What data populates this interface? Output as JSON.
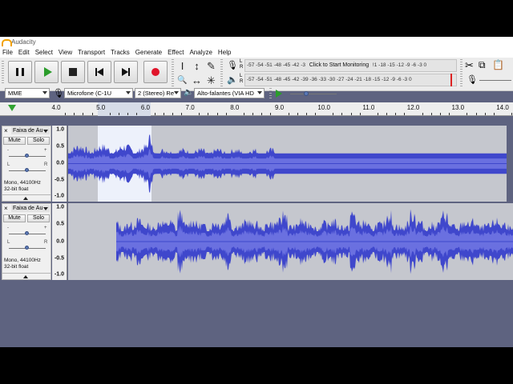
{
  "window": {
    "title": "Audacity"
  },
  "menu": [
    "File",
    "Edit",
    "Select",
    "View",
    "Transport",
    "Tracks",
    "Generate",
    "Effect",
    "Analyze",
    "Help"
  ],
  "transport": {
    "pause_icon": "pause-icon",
    "play_icon": "play-icon",
    "stop_icon": "stop-icon",
    "skip_start_icon": "skip-to-start-icon",
    "skip_end_icon": "skip-to-end-icon",
    "record_icon": "record-icon"
  },
  "tools": {
    "selection": "I",
    "envelope": "↕",
    "draw": "✎",
    "zoom": "🔍",
    "timeshift": "↔",
    "multi": "✳"
  },
  "meters": {
    "record_scale": "-57 -54 -51 -48 -45 -42 -3",
    "record_prompt": "Click to Start Monitoring",
    "record_scale_right": "!1 -18 -15 -12 -9 -6 -3 0",
    "playback_scale": "-57 -54 -51 -48 -45 -42 -39 -36 -33 -30 -27 -24 -21 -18 -15 -12 -9 -6 -3 0",
    "record_left": "L",
    "record_right": "R",
    "play_left": "L",
    "play_right": "R"
  },
  "device_toolbar": {
    "host": "MME",
    "input_device": "Microfone (C-1U",
    "channels": "2 (Stereo) Re",
    "output_device": "Alto-falantes (VIA HD"
  },
  "timeline": {
    "labels": [
      "4.0",
      "5.0",
      "6.0",
      "7.0",
      "8.0",
      "9.0",
      "10.0",
      "11.0",
      "12.0",
      "13.0",
      "14.0"
    ]
  },
  "tracks": [
    {
      "name": "Faixa de Áu",
      "mute": "Mute",
      "solo": "Solo",
      "gain_minus": "-",
      "gain_plus": "+",
      "pan_left": "L",
      "pan_right": "R",
      "rate": "Mono, 44100Hz",
      "format": "32-bit float",
      "scale": [
        "1.0",
        "0.5",
        "0.0",
        "-0.5",
        "-1.0"
      ]
    },
    {
      "name": "Faixa de Áu",
      "mute": "Mute",
      "solo": "Solo",
      "gain_minus": "-",
      "gain_plus": "+",
      "pan_left": "L",
      "pan_right": "R",
      "rate": "Mono, 44100Hz",
      "format": "32-bit float",
      "scale": [
        "1.0",
        "0.5",
        "0.0",
        "-0.5",
        "-1.0"
      ]
    }
  ],
  "colors": {
    "waveform": "#3f47cc",
    "waveform_rms": "#6a70e0",
    "track_bg": "#c5c7ce",
    "selection_bg": "#edf1fb",
    "panel_bg": "#5e6380"
  }
}
